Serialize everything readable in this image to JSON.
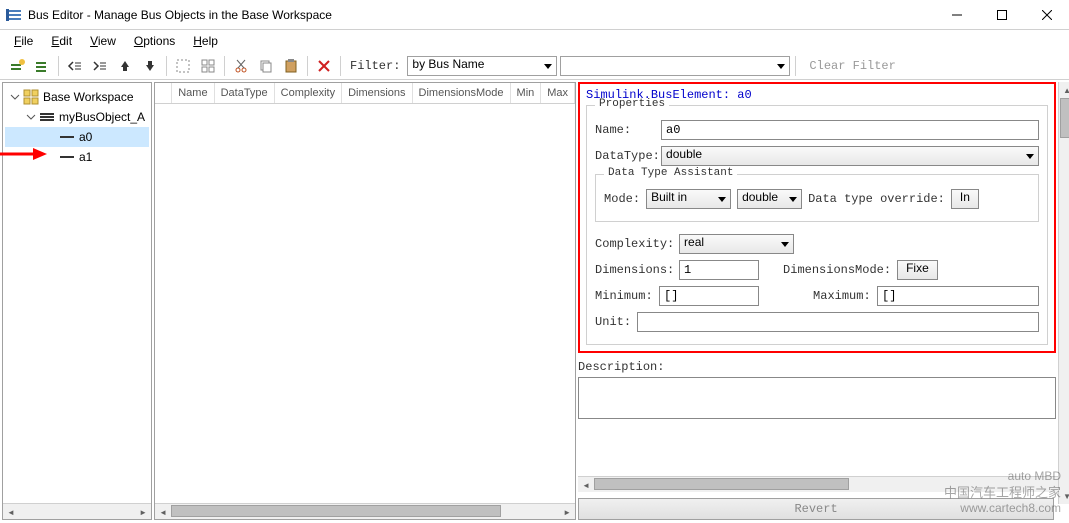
{
  "title": "Bus Editor - Manage Bus Objects in the Base Workspace",
  "menus": {
    "file": "File",
    "edit": "Edit",
    "view": "View",
    "options": "Options",
    "help": "Help"
  },
  "filter": {
    "label": "Filter:",
    "mode": "by Bus Name",
    "value": "",
    "clear": "Clear Filter"
  },
  "tree": {
    "root": "Base Workspace",
    "bus": "myBusObject_A",
    "elements": [
      "a0",
      "a1"
    ],
    "selected": "a0"
  },
  "table": {
    "headers": [
      "Name",
      "DataType",
      "Complexity",
      "Dimensions",
      "DimensionsMode",
      "Min",
      "Max"
    ]
  },
  "details": {
    "heading": "Simulink.BusElement: a0",
    "properties_legend": "Properties",
    "name_label": "Name:",
    "name_value": "a0",
    "datatype_label": "DataType:",
    "datatype_value": "double",
    "dta_legend": "Data Type Assistant",
    "mode_label": "Mode:",
    "mode_value": "Built in",
    "mode_secondary": "double",
    "override_label": "Data type override:",
    "override_value": "In",
    "complexity_label": "Complexity:",
    "complexity_value": "real",
    "dimensions_label": "Dimensions:",
    "dimensions_value": "1",
    "dimmode_label": "DimensionsMode:",
    "dimmode_value": "Fixe",
    "min_label": "Minimum:",
    "min_value": "[]",
    "max_label": "Maximum:",
    "max_value": "[]",
    "unit_label": "Unit:",
    "unit_value": "",
    "description_label": "Description:",
    "revert": "Revert"
  },
  "watermark": {
    "brand": "auto MBD",
    "cn": "中国汽车工程师之家",
    "url": "www.cartech8.com"
  }
}
